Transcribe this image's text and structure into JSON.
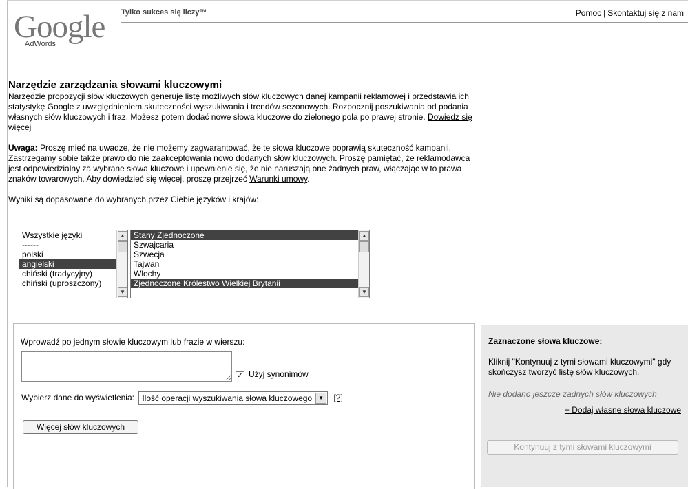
{
  "header": {
    "logo_text": "Google",
    "logo_sub": "AdWords",
    "tagline": "Tylko sukces się liczy™",
    "help_link": "Pomoc",
    "separator": "|",
    "contact_link": "Skontaktuj się z nam"
  },
  "intro": {
    "title": "Narzędzie zarządzania słowami kluczowymi",
    "p1_a": "Narzędzie propozycji słów kluczowych generuje listę możliwych ",
    "p1_link": "słów kluczowych danej kampanii reklamowej",
    "p1_b": " i przedstawia ich statystykę Google z uwzględnieniem skuteczności wyszukiwania i trendów sezonowych. Rozpocznij poszukiwania od podania własnych słów kluczowych i fraz. Możesz potem dodać nowe słowa kluczowe do zielonego pola po prawej stronie. ",
    "p1_more": "Dowiedz się więcej",
    "warn_label": "Uwaga:",
    "warn_text": " Proszę mieć na uwadze, że nie możemy zagwarantować, że te słowa kluczowe poprawią skuteczność kampanii. Zastrzegamy sobie także prawo do nie zaakceptowania nowo dodanych słów kluczowych. Proszę pamiętać, że reklamodawca jest odpowiedzialny za wybrane słowa kluczowe i upewnienie się, że nie naruszają one żadnych praw, włączając w to prawa znaków towarowych. Aby dowiedzieć się więcej, proszę przejrzeć ",
    "warn_link": "Warunki umowy",
    "warn_end": ".",
    "match_text": "Wyniki są dopasowane do wybranych przez Ciebie języków i krajów:"
  },
  "languages": {
    "options": [
      "Wszystkie języki",
      "------",
      "polski",
      "angielski",
      "chiński (tradycyjny)",
      "chiński (uproszczony)"
    ],
    "selected": "angielski"
  },
  "countries": {
    "options": [
      "Stany Zjednoczone",
      "Szwajcaria",
      "Szwecja",
      "Tajwan",
      "Włochy",
      "Zjednoczone Królestwo Wielkiej Brytanii"
    ],
    "selected": [
      "Stany Zjednoczone",
      "Zjednoczone Królestwo Wielkiej Brytanii"
    ]
  },
  "form": {
    "input_label": "Wprowadź po jednym słowie kluczowym lub frazie w wierszu:",
    "keywords_value": "",
    "synonyms_checked": true,
    "synonyms_label": "Użyj synonimów",
    "data_label": "Wybierz dane do wyświetlenia:",
    "data_select": "Ilość operacji wyszukiwania słowa kluczowego",
    "help_link": "[?]",
    "more_button": "Więcej słów kluczowych"
  },
  "selected_panel": {
    "title": "Zaznaczone słowa kluczowe:",
    "description": "Kliknij \"Kontynuuj z tymi słowami kluczowymi\" gdy skończysz tworzyć listę słów kluczowych.",
    "empty_text": "Nie dodano jeszcze żadnych słów kluczowych",
    "add_link": "+ Dodaj własne słowa kluczowe",
    "continue_button": "Kontynuuj z tymi słowami kluczowymi"
  }
}
